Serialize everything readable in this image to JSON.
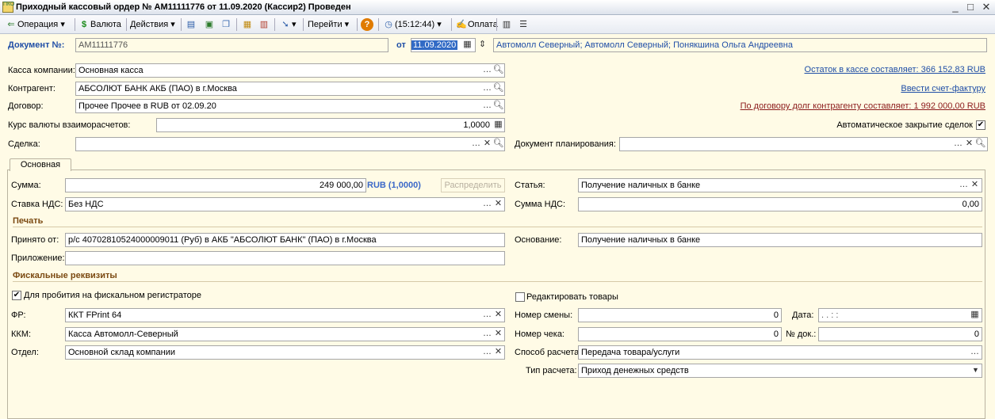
{
  "window": {
    "title": "Приходный кассовый ордер № АМ11111776 от 11.09.2020 (Кассир2) Проведен",
    "icon_text": "ПКО",
    "minimize": "_",
    "restore": "□",
    "close": "✕"
  },
  "toolbar": {
    "operation": "Операция",
    "currency": "Валюта",
    "actions": "Действия",
    "goto": "Перейти",
    "time": "(15:12:44)",
    "payment": "Оплата"
  },
  "doc": {
    "number_label": "Документ №:",
    "number": "АМ11111776",
    "date_label": "от",
    "date": "11.09.2020",
    "org": "Автомолл Северный; Автомолл Северный; Понякшина Ольга Андреевна"
  },
  "fields": {
    "kassa_label": "Касса компании:",
    "kassa": "Основная касса",
    "kontragent_label": "Контрагент:",
    "kontragent": "АБСОЛЮТ БАНК АКБ (ПАО) в г.Москва",
    "dogovor_label": "Договор:",
    "dogovor": "Прочее Прочее в RUB от 02.09.20",
    "kurs_label": "Курс валюты взаиморасчетов:",
    "kurs": "1,0000",
    "sdelka_label": "Сделка:",
    "sdelka": "",
    "docplan_label": "Документ планирования:",
    "docplan": ""
  },
  "links": {
    "ostatok": "Остаток в кассе составляет: 366 152,83 RUB",
    "schet": "Ввести счет-фактуру",
    "dolg": "По договору долг контрагенту составляет: 1 992 000,00 RUB"
  },
  "auto_close": {
    "label": "Автоматическое закрытие сделок",
    "checked": true
  },
  "tab": {
    "label": "Основная"
  },
  "main": {
    "summa_label": "Сумма:",
    "summa": "249 000,00",
    "summa_cur": "RUB (1,0000)",
    "raspredelit": "Распределить",
    "statya_label": "Статья:",
    "statya": "Получение наличных в банке",
    "nds_rate_label": "Ставка НДС:",
    "nds_rate": "Без НДС",
    "nds_sum_label": "Сумма НДС:",
    "nds_sum": "0,00"
  },
  "print": {
    "header": "Печать",
    "prinyato_label": "Принято от:",
    "prinyato": "р/с 40702810524000009011 (Руб) в АКБ \"АБСОЛЮТ БАНК\" (ПАО) в г.Москва",
    "osnovanie_label": "Основание:",
    "osnovanie": "Получение наличных в банке",
    "prilozhenie_label": "Приложение:",
    "prilozhenie": ""
  },
  "fiscal": {
    "header": "Фискальные реквизиты",
    "reg_label": "Для пробития на фискальном регистраторе",
    "reg_checked": true,
    "edit_label": "Редактировать товары",
    "edit_checked": false,
    "fr_label": "ФР:",
    "fr": "ККТ FPrint 64",
    "kkm_label": "ККМ:",
    "kkm": "Касса Автомолл-Северный",
    "otdel_label": "Отдел:",
    "otdel": "Основной склад компании",
    "smena_label": "Номер смены:",
    "smena": "0",
    "data_label": "Дата:",
    "data": ". .   : :",
    "check_label": "Номер чека:",
    "check": "0",
    "nomdok_label": "№ док.:",
    "nomdok": "0",
    "sposob_label": "Способ расчета:",
    "sposob": "Передача товара/услуги",
    "tip_label": "Тип расчета:",
    "tip": "Приход денежных средств"
  }
}
